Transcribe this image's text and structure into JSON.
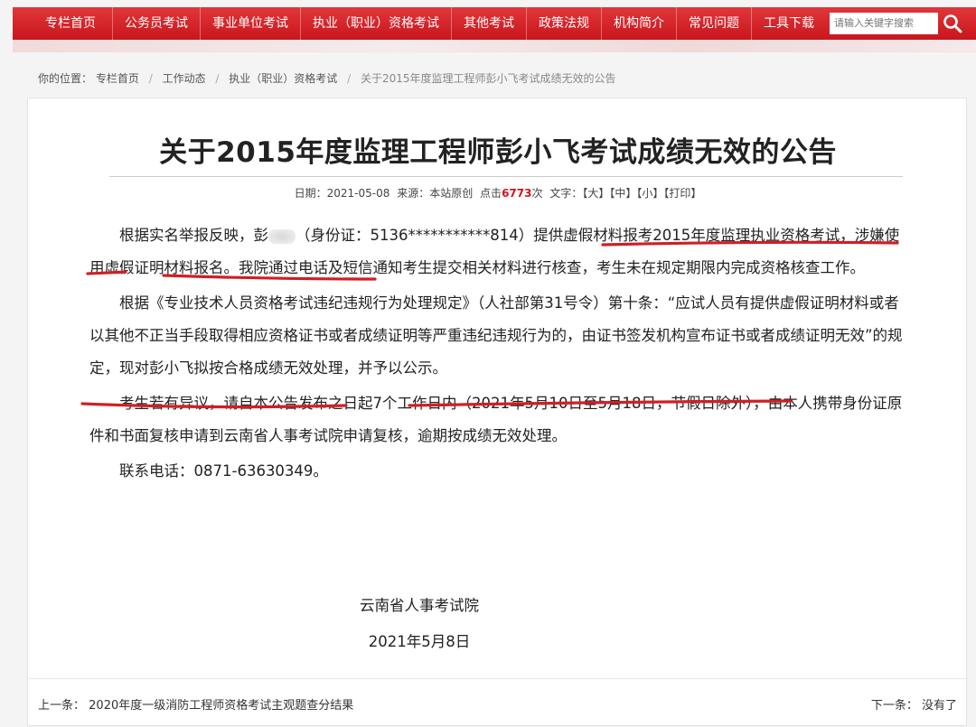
{
  "nav": {
    "items": [
      "专栏首页",
      "公务员考试",
      "事业单位考试",
      "执业（职业）资格考试",
      "其他考试",
      "政策法规",
      "机构简介",
      "常见问题",
      "工具下载"
    ],
    "search_placeholder": "请输入关键字搜索"
  },
  "breadcrumb": {
    "prefix": "你的位置：",
    "items": [
      "专栏首页",
      "工作动态",
      "执业（职业）资格考试"
    ],
    "current": "关于2015年度监理工程师彭小飞考试成绩无效的公告"
  },
  "article": {
    "title": "关于2015年度监理工程师彭小飞考试成绩无效的公告",
    "meta": {
      "date_label": "日期：",
      "date": "2021-05-08",
      "source_label": "来源：",
      "source": "本站原创",
      "hits_label": "点击",
      "hits": "6773",
      "hits_unit": "次",
      "font_label": "文字：",
      "large": "【大】",
      "medium": "【中】",
      "small": "【小】",
      "print": "【打印】"
    },
    "p1_a": "根据实名举报反映，彭",
    "p1_b": "（身份证：5136***********814）提供虚假材料报考2015年度监理执业资格考试，涉嫌使用虚假证明材料报名。我院通过电话及短信通知考生提交相关材料进行核查，考生未在规定期限内完成资格核查工作。",
    "p2": "根据《专业技术人员资格考试违纪违规行为处理规定》（人社部第31号令）第十条：“应试人员有提供虚假证明材料或者以其他不正当手段取得相应资格证书或者成绩证明等严重违纪违规行为的，由证书签发机构宣布证书或者成绩证明无效”的规定，现对彭小飞拟按合格成绩无效处理，并予以公示。",
    "p3": "考生若有异议，请自本公告发布之日起7个工作日内（2021年5月10日至5月18日，节假日除外），由本人携带身份证原件和书面复核申请到云南省人事考试院申请复核，逾期按成绩无效处理。",
    "p4": "联系电话：0871-63630349。",
    "org": "云南省人事考试院",
    "date_sign": "2021年5月8日"
  },
  "footer": {
    "prev_label": "上一条：",
    "prev_title": "2020年度一级消防工程师资格考试主观题查分结果",
    "next_label": "下一条：",
    "next_title": "没有了"
  },
  "colors": {
    "nav_red": "#c8161d",
    "underline_red": "#d01f25",
    "hits_red": "#d2141c"
  },
  "icons": {
    "search": "search-icon"
  }
}
